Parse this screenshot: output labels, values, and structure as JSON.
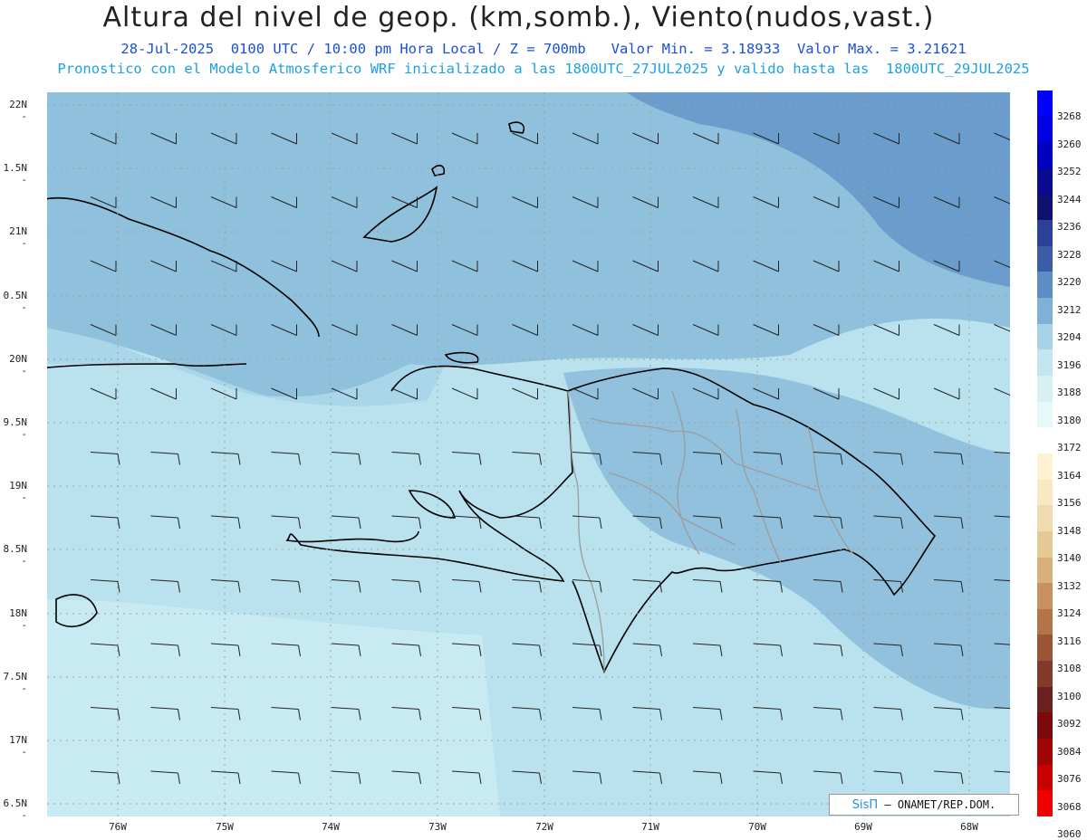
{
  "title": "Altura del nivel de geop. (km,somb.), Viento(nudos,vast.)",
  "subtitle1": "28-Jul-2025  0100 UTC / 10:00 pm Hora Local / Z = 700mb   Valor Min. = 3.18933  Valor Max. = 3.21621",
  "subtitle2": "Pronostico con el Modelo Atmosferico WRF inicializado a las 1800UTC_27JUL2025 y valido hasta las  1800UTC_29JUL2025",
  "lat_labels": [
    "22N",
    "1.5N",
    "21N",
    "0.5N",
    "20N",
    "9.5N",
    "19N",
    "8.5N",
    "18N",
    "7.5N",
    "17N",
    "6.5N"
  ],
  "lon_labels": [
    "76W",
    "75W",
    "74W",
    "73W",
    "72W",
    "71W",
    "70W",
    "69W",
    "68W"
  ],
  "colorbar": {
    "labels": [
      "3268",
      "3260",
      "3252",
      "3244",
      "3236",
      "3228",
      "3220",
      "3212",
      "3204",
      "3196",
      "3188",
      "3180",
      "3172",
      "3164",
      "3156",
      "3148",
      "3140",
      "3132",
      "3124",
      "3116",
      "3108",
      "3100",
      "3092",
      "3084",
      "3076",
      "3068",
      "3060"
    ],
    "colors": [
      "#0000ff",
      "#0000e0",
      "#0000c0",
      "#0a0a90",
      "#101070",
      "#2b3f9b",
      "#3d5ca8",
      "#5c8ec4",
      "#7eb0d8",
      "#a8d2e6",
      "#c4e4ef",
      "#d8f0f4",
      "#e6f8f9",
      "#ffffff",
      "#fdf3d4",
      "#f8e9c2",
      "#f0dbb0",
      "#e5c894",
      "#d9b07a",
      "#c99060",
      "#b4744a",
      "#9c5437",
      "#84392b",
      "#6b1f1f",
      "#7d0a0a",
      "#a00505",
      "#c80000",
      "#f00000"
    ]
  },
  "credit": {
    "brand": "SisΠ",
    "org": "– ONAMET/REP.DOM."
  }
}
